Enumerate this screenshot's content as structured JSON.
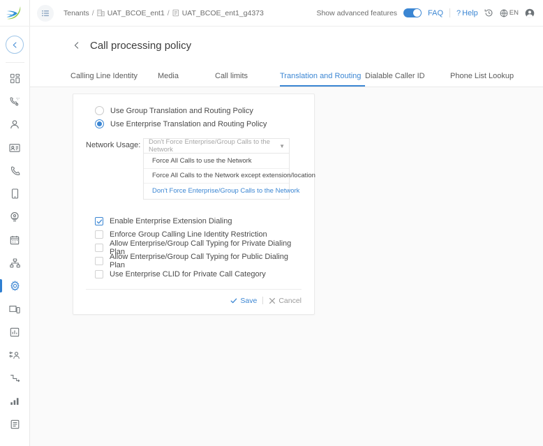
{
  "brand": {
    "logo_name": "swoosh-logo",
    "accent": "#3b86d3",
    "active_nav": "settings"
  },
  "sidebar": {
    "collapse_label": "collapse-sidebar",
    "items": [
      {
        "name": "dashboard",
        "icon": "dashboard-icon"
      },
      {
        "name": "call-center",
        "icon": "call-center-icon"
      },
      {
        "name": "users",
        "icon": "user-icon"
      },
      {
        "name": "id-card",
        "icon": "id-card-icon"
      },
      {
        "name": "phone",
        "icon": "phone-icon"
      },
      {
        "name": "mobile",
        "icon": "mobile-icon"
      },
      {
        "name": "location",
        "icon": "location-pin-icon"
      },
      {
        "name": "calendar",
        "icon": "calendar-icon"
      },
      {
        "name": "org-chart",
        "icon": "org-chart-icon"
      },
      {
        "name": "settings",
        "icon": "gear-icon"
      },
      {
        "name": "devices",
        "icon": "devices-icon"
      },
      {
        "name": "reports-doc",
        "icon": "document-chart-icon"
      },
      {
        "name": "user-routing",
        "icon": "user-routing-icon"
      },
      {
        "name": "call-flow",
        "icon": "call-flow-icon"
      },
      {
        "name": "analytics",
        "icon": "bar-chart-icon"
      },
      {
        "name": "logs",
        "icon": "list-document-icon"
      }
    ]
  },
  "topbar": {
    "menu_icon": "hamburger-menu-icon",
    "breadcrumb": [
      {
        "label": "Tenants",
        "icon": null,
        "sep": "/"
      },
      {
        "label": "UAT_BCOE_ent1",
        "icon": "building-icon",
        "sep": "/"
      },
      {
        "label": "UAT_BCOE_ent1_g4373",
        "icon": "group-document-icon",
        "sep": ""
      }
    ],
    "advanced_features_label": "Show advanced features",
    "advanced_features_on": true,
    "faq_label": "FAQ",
    "help_label": "Help",
    "help_prefix": "?",
    "history_icon": "history-icon",
    "globe_icon": "globe-icon",
    "language": "EN",
    "account_icon": "account-circle-icon"
  },
  "page": {
    "back_icon": "chevron-left-icon",
    "title": "Call processing policy",
    "tabs": [
      {
        "label": "Calling Line Identity",
        "active": false
      },
      {
        "label": "Media",
        "active": false
      },
      {
        "label": "Call limits",
        "active": false
      },
      {
        "label": "Translation and Routing",
        "active": true
      },
      {
        "label": "Dialable Caller ID",
        "active": false
      },
      {
        "label": "Phone List Lookup",
        "active": false
      }
    ]
  },
  "form": {
    "policy_radios": [
      {
        "label": "Use Group Translation and Routing Policy",
        "checked": false
      },
      {
        "label": "Use Enterprise Translation and Routing Policy",
        "checked": true
      }
    ],
    "network_usage": {
      "label": "Network Usage:",
      "value": "Don't Force Enterprise/Group Calls to the Network",
      "open": true,
      "caret_icon": "chevron-down-icon",
      "options": [
        {
          "label": "Force All Calls to use the Network",
          "selected": false
        },
        {
          "label": "Force All Calls to the Network except extension/location",
          "selected": false
        },
        {
          "label": "Don't Force Enterprise/Group Calls to the Network",
          "selected": true
        }
      ]
    },
    "checkboxes": [
      {
        "label": "Enable Enterprise Extension Dialing",
        "checked": true
      },
      {
        "label": "Enforce Group Calling Line Identity Restriction",
        "checked": false
      },
      {
        "label": "Allow Enterprise/Group Call Typing for Private Dialing Plan",
        "checked": false
      },
      {
        "label": "Allow Enterprise/Group Call Typing for Public Dialing Plan",
        "checked": false
      },
      {
        "label": "Use Enterprise CLID for Private Call Category",
        "checked": false
      }
    ],
    "save_label": "Save",
    "cancel_label": "Cancel",
    "save_icon": "check-icon",
    "cancel_icon": "close-x-icon"
  }
}
